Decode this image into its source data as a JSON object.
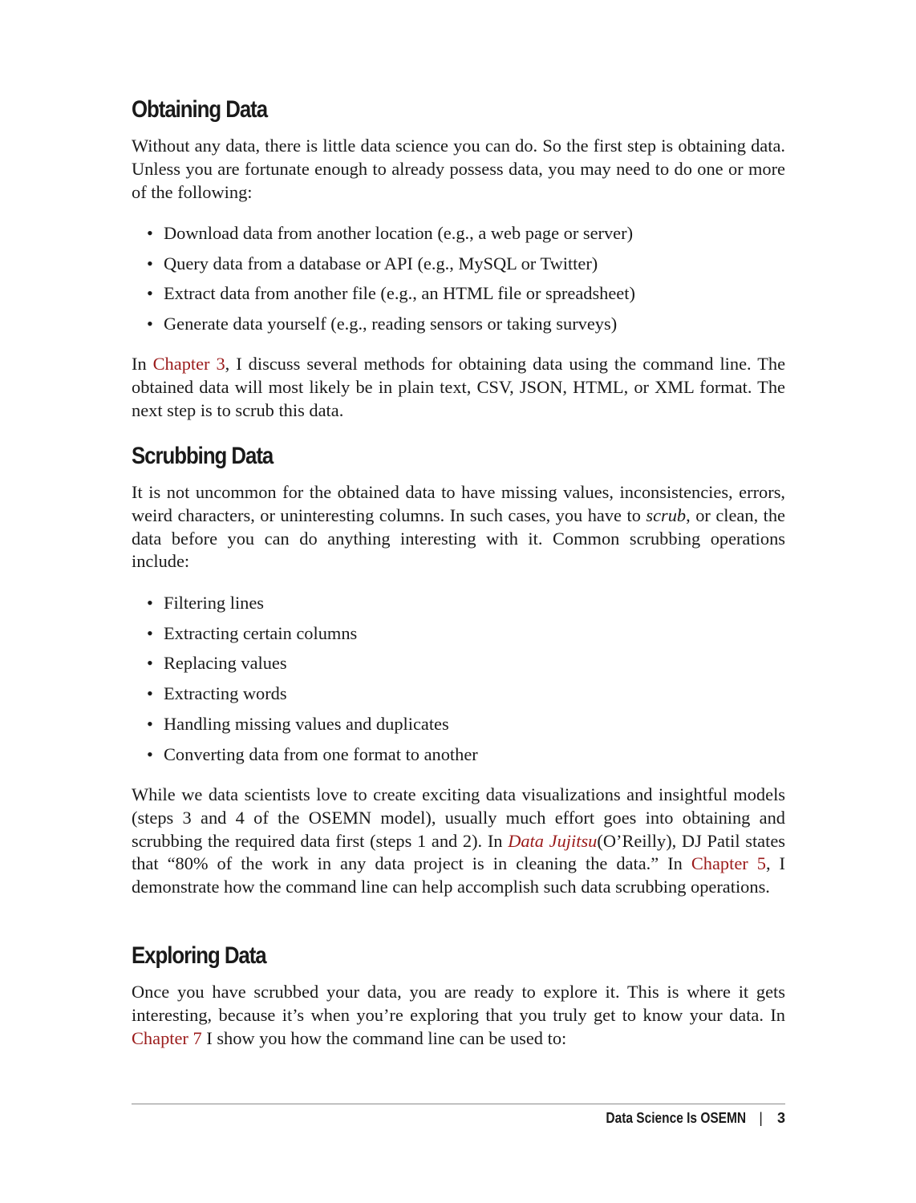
{
  "sections": [
    {
      "heading": "Obtaining Data",
      "intro": "Without any data, there is little data science you can do. So the first step is obtaining data. Unless you are fortunate enough to already possess data, you may need to do one or more of the following:",
      "bullets": [
        "Download data from another location (e.g., a web page or server)",
        "Query data from a database or API (e.g., MySQL or Twitter)",
        "Extract data from another file (e.g., an HTML file or spreadsheet)",
        "Generate data yourself (e.g., reading sensors or taking surveys)"
      ],
      "outro": {
        "pre": "In ",
        "link": "Chapter 3",
        "post": ", I discuss several methods for obtaining data using the command line. The obtained data will most likely be in plain text, CSV, JSON, HTML, or XML format. The next step is to scrub this data."
      }
    },
    {
      "heading": "Scrubbing Data",
      "intro": {
        "pre": "It is not uncommon for the obtained data to have missing values, inconsistencies, errors, weird characters, or uninteresting columns. In such cases, you have to ",
        "em": "scrub",
        "post": ", or clean, the data before you can do anything interesting with it. Common scrubbing operations include:"
      },
      "bullets": [
        "Filtering lines",
        "Extracting certain columns",
        "Replacing values",
        "Extracting words",
        "Handling missing values and duplicates",
        "Converting data from one format to another"
      ],
      "outro": {
        "t1": "While we data scientists love to create exciting data visualizations and insightful models (steps 3 and 4 of the OSEMN model), usually much effort goes into obtaining and scrubbing the required data first (steps 1 and 2). In ",
        "link1": "Data Jujitsu",
        "t2": "(O’Reilly), DJ Patil states that “80% of the work in any data project is in cleaning the data.” In ",
        "link2": "Chapter 5",
        "t3": ", I demonstrate how the command line can help accomplish such data scrubbing operations."
      }
    },
    {
      "heading": "Exploring Data",
      "intro": {
        "t1": "Once you have scrubbed your data, you are ready to explore it. This is where it gets interesting, because it’s when you’re exploring that you truly get to know your data. In ",
        "link": "Chapter 7",
        "t2": " I show you how the command line can be used to:"
      }
    }
  ],
  "footer": {
    "title": "Data Science Is OSEMN",
    "separator": "|",
    "page_number": "3"
  },
  "colors": {
    "link": "#9b1b1b",
    "text": "#1a1a1a"
  }
}
